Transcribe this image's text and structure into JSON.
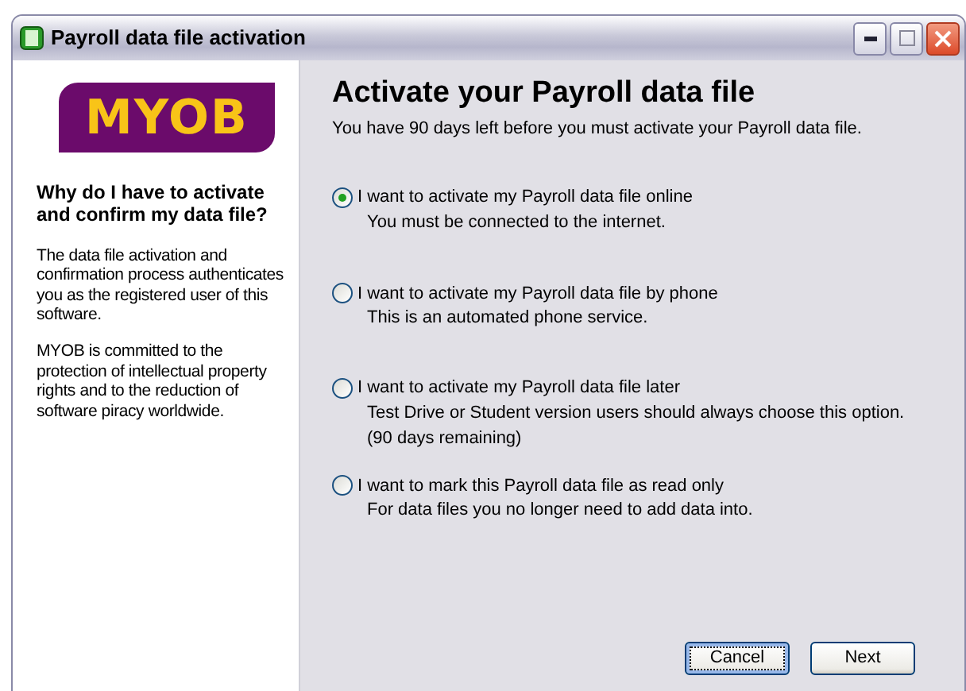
{
  "window": {
    "title": "Payroll data file activation"
  },
  "sidebar": {
    "logo": "MYOB",
    "question": "Why do I have to activate and confirm my data file?",
    "paragraphs": [
      "The data file activation and confirmation process authenticates you as the registered user of this software.",
      "MYOB is committed to the protection of intellectual property rights and to the reduction of software piracy worldwide."
    ]
  },
  "heading": "Activate your Payroll data file",
  "subtitle": "You have 90 days left before you must activate your Payroll data file.",
  "options": [
    {
      "label": "I want to activate my Payroll data file online",
      "selected": true,
      "notes": [
        "You must be connected to the internet."
      ]
    },
    {
      "label": "I want to activate my Payroll data file by phone",
      "selected": false,
      "notes": [
        "This is an automated phone service."
      ]
    },
    {
      "label": "I want to activate my Payroll data file later",
      "selected": false,
      "notes": [
        "Test Drive or Student version users should always choose this option.",
        "(90 days remaining)"
      ]
    },
    {
      "label": "I want to mark this Payroll data file as read only",
      "selected": false,
      "notes": [
        "For data files you no longer need to add data into."
      ]
    }
  ],
  "buttons": [
    {
      "label": "Cancel",
      "focused": true
    },
    {
      "label": "Next",
      "focused": false
    }
  ]
}
